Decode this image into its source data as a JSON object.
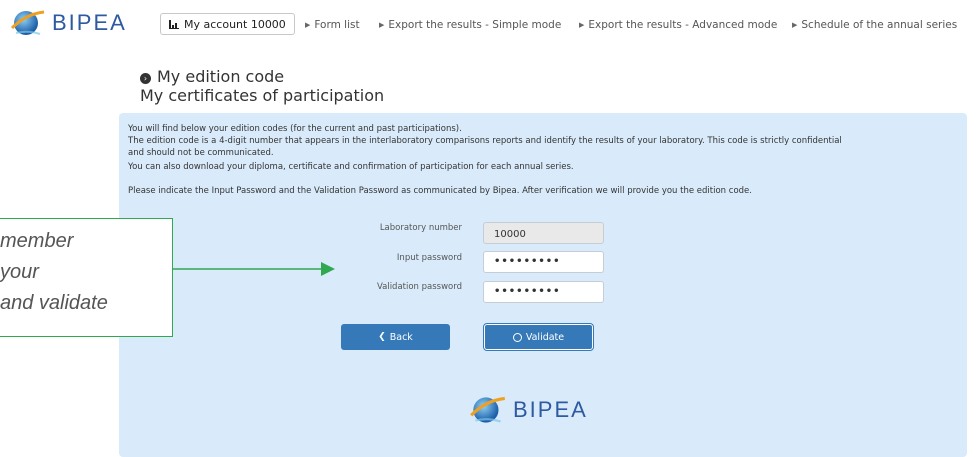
{
  "header": {
    "logo_text": "BIPEA",
    "account_label": "My account 10000",
    "nav": [
      "Form list",
      "Export the results - Simple mode",
      "Export the results - Advanced mode",
      "Schedule of the annual series"
    ]
  },
  "titles": {
    "edition_code": "My edition code",
    "certificates": "My certificates of participation"
  },
  "panel": {
    "paragraphs": [
      "You will find below your edition codes (for the current and past participations).",
      "The edition code is a 4-digit number that appears in the interlaboratory comparisons reports and identify the results of your laboratory. This code is strictly confidential",
      "and should not be communicated.",
      "You can also download your diploma, certificate and confirmation of participation for each annual series.",
      "Please indicate the Input Password and the Validation Password as communicated by Bipea. After verification we will provide you the edition code."
    ],
    "form": {
      "lab_number_label": "Laboratory number",
      "lab_number_value": "10000",
      "input_password_label": "Input password",
      "input_password_value": "•••••••••",
      "validation_password_label": "Validation password",
      "validation_password_value": "•••••••••"
    },
    "back_label": "Back",
    "validate_label": "Validate",
    "footer_logo_text": "BIPEA"
  },
  "callout": {
    "lines": [
      "member",
      "your",
      "and validate"
    ]
  },
  "colors": {
    "brand": "#2d5aa0",
    "panel_bg": "#d9ebfa",
    "button": "#3579b8",
    "callout_border": "#2fa84f"
  }
}
